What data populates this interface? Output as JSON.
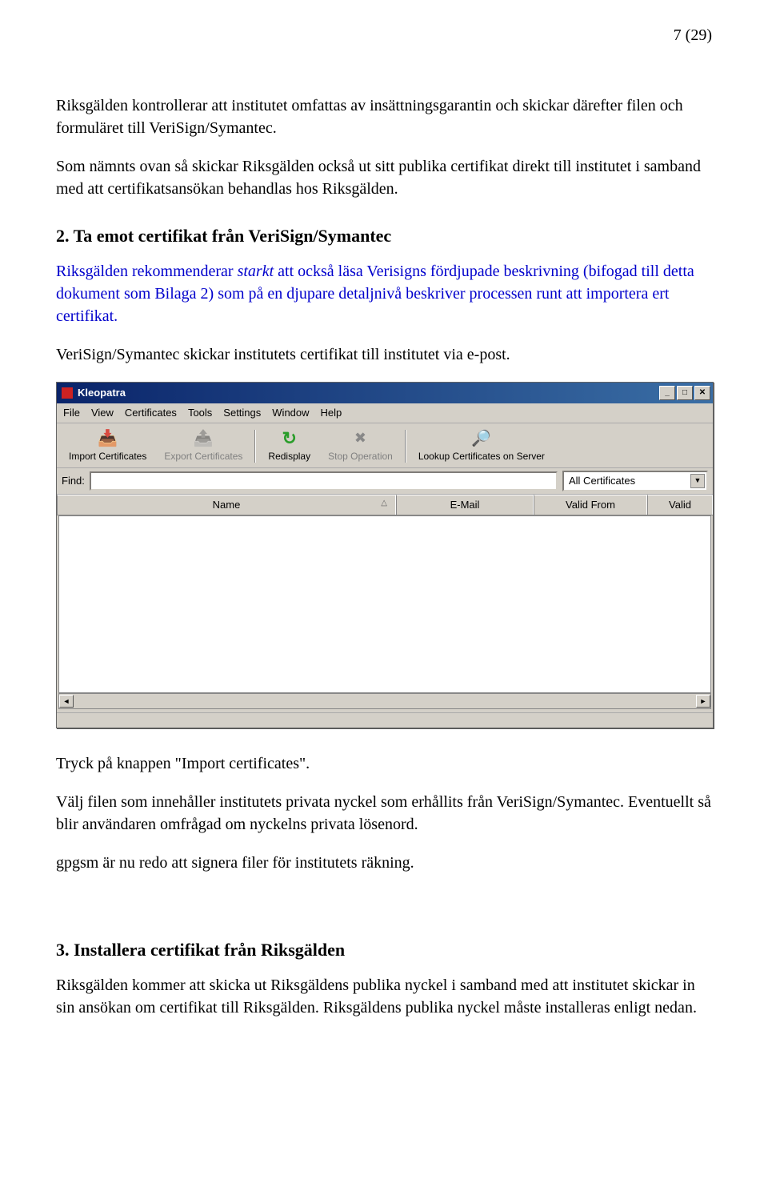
{
  "page_number": "7 (29)",
  "para1": "Riksgälden kontrollerar att institutet omfattas av insättningsgarantin och skickar därefter filen och formuläret till VeriSign/Symantec.",
  "para2": "Som nämnts ovan så skickar Riksgälden också ut sitt publika certifikat direkt till institutet i samband med att certifikatsansökan behandlas hos Riksgälden.",
  "heading2": "2. Ta emot certifikat från VeriSign/Symantec",
  "blue_note_pre": "Riksgälden rekommenderar ",
  "blue_note_bold": "starkt",
  "blue_note_post": " att också läsa Verisigns fördjupade beskrivning (bifogad till detta dokument som Bilaga 2) som på en djupare detaljnivå beskriver processen runt att importera ert certifikat.",
  "para3": "VeriSign/Symantec skickar institutets certifikat till institutet via e-post.",
  "kleo": {
    "title": "Kleopatra",
    "menu": {
      "file": "File",
      "view": "View",
      "certificates": "Certificates",
      "tools": "Tools",
      "settings": "Settings",
      "window": "Window",
      "help": "Help"
    },
    "toolbar": {
      "import": "Import Certificates",
      "export": "Export Certificates",
      "redisplay": "Redisplay",
      "stop": "Stop Operation",
      "lookup": "Lookup Certificates on Server"
    },
    "find_label": "Find:",
    "filter_select": "All Certificates",
    "columns": {
      "name": "Name",
      "email": "E-Mail",
      "valid_from": "Valid From",
      "valid": "Valid"
    }
  },
  "para4": "Tryck på knappen \"Import certificates\".",
  "para5": "Välj filen som innehåller institutets privata nyckel som erhållits från VeriSign/Symantec. Eventuellt så blir användaren omfrågad om nyckelns privata lösenord.",
  "para6": "gpgsm är nu redo att signera filer för institutets räkning.",
  "heading3": "3. Installera certifikat från Riksgälden",
  "para7": "Riksgälden kommer att skicka ut Riksgäldens publika nyckel i samband med att institutet skickar in sin ansökan om certifikat till Riksgälden. Riksgäldens publika nyckel måste installeras enligt nedan."
}
